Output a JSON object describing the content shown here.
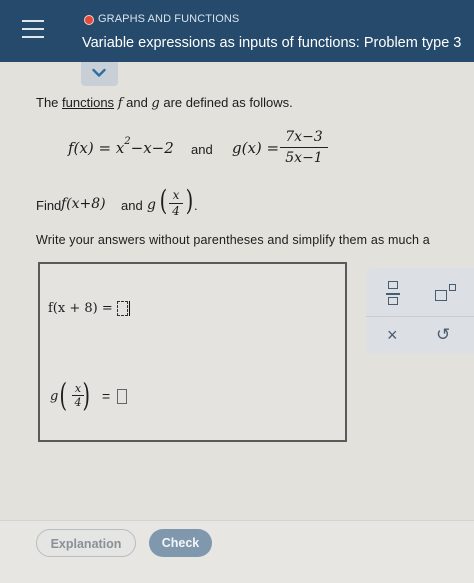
{
  "header": {
    "topic": "GRAPHS AND FUNCTIONS",
    "title": "Variable expressions as inputs of functions: Problem type 3"
  },
  "problem": {
    "intro_pre": "The ",
    "intro_link": "functions",
    "intro_f": "f",
    "intro_mid": " and ",
    "intro_g": "g",
    "intro_post": " are defined as follows.",
    "f_def": "f(x) = x",
    "f_exp": "2",
    "f_rest": "−x−2",
    "and": "and",
    "g_lhs": "g(x) =",
    "g_num": "7x−3",
    "g_den": "5x−1",
    "find_word": "Find",
    "find_f": "f(x+8)",
    "find_and": "and",
    "find_g": "g",
    "find_g_num": "x",
    "find_g_den": "4",
    "find_dot": ".",
    "instruction": "Write your answers without parentheses and simplify them as much a"
  },
  "answer": {
    "f_label": "f(x + 8) =",
    "g_letter": "g",
    "g_num": "x",
    "g_den": "4",
    "eq": "="
  },
  "tools": {
    "clear": "×",
    "undo": "↺"
  },
  "footer": {
    "explanation": "Explanation",
    "check": "Check"
  },
  "colors": {
    "header_bg": "#254a6b",
    "check_bg": "#7f98ae",
    "topic_dot": "#e24a3b"
  }
}
